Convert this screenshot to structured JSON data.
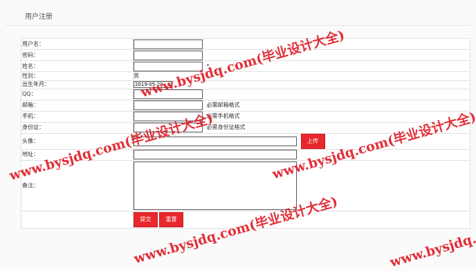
{
  "page": {
    "title": "用户注册"
  },
  "form": {
    "username": {
      "label": "用户名：",
      "value": ""
    },
    "password": {
      "label": "密码：",
      "value": ""
    },
    "name": {
      "label": "姓名：",
      "value": "",
      "required_mark": "*"
    },
    "gender": {
      "label": "性别：",
      "value": "男"
    },
    "birthdate": {
      "label": "出生年月：",
      "value": "2019-05-20"
    },
    "qq": {
      "label": "QQ：",
      "value": ""
    },
    "email": {
      "label": "邮箱：",
      "value": "",
      "hint": "必需邮箱格式"
    },
    "phone": {
      "label": "手机：",
      "value": "",
      "hint": "必需手机格式"
    },
    "id_card": {
      "label": "身份证：",
      "value": "",
      "hint": "必需身份证格式"
    },
    "avatar": {
      "label": "头像：",
      "value": "",
      "upload_label": "上传"
    },
    "address": {
      "label": "地址：",
      "value": ""
    },
    "remark": {
      "label": "备注：",
      "value": ""
    },
    "submit_label": "提交",
    "reset_label": "重置"
  },
  "watermark": {
    "text": "www.bysjdq.com(毕业设计大全)"
  },
  "colors": {
    "accent": "#e8282e",
    "watermark": "#e0202a"
  }
}
